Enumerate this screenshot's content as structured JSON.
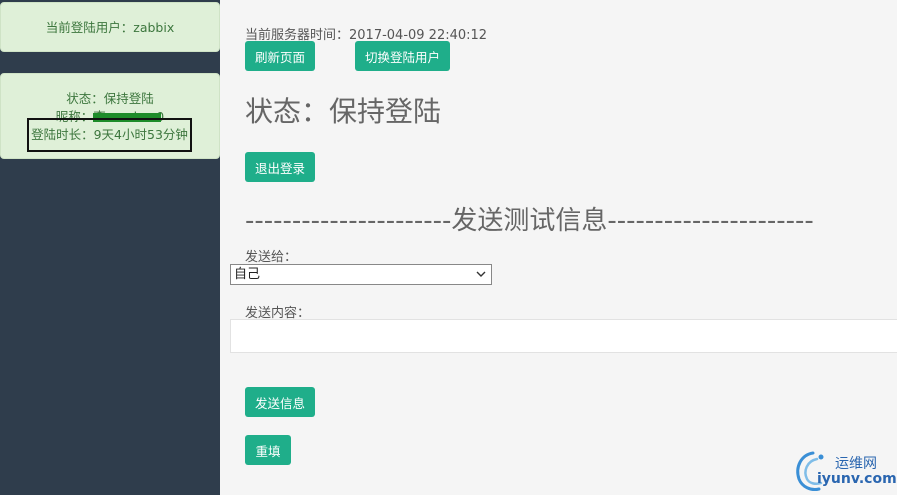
{
  "sidebar": {
    "current_user": "当前登陆用户：zabbix",
    "status_line": "状态：保持登陆",
    "nickname_line": "昵称：李·······ly□0",
    "duration_line": "登陆时长：9天4小时53分钟"
  },
  "main": {
    "server_time": "当前服务器时间：2017-04-09 22:40:12",
    "refresh_label": "刷新页面",
    "switch_user_label": "切换登陆用户",
    "status_title": "状态：保持登陆",
    "logout_label": "退出登录",
    "section_title": "----------------------发送测试信息----------------------",
    "send_to_label": "发送给：",
    "send_to_value": "自己",
    "content_label": "发送内容：",
    "content_value": "",
    "send_label": "发送信息",
    "reset_label": "重填"
  },
  "watermark": {
    "cn": "运维网",
    "en": "iyunv.com"
  },
  "colors": {
    "sidebar_bg": "#2f3d4c",
    "card_bg": "#dff0d8",
    "card_text": "#3c763d",
    "button_bg": "#1fae8a",
    "watermark": "#2a66b0"
  },
  "icons": {
    "select_arrow": "chevron-down-icon",
    "watermark_logo": "swirl-logo-icon"
  }
}
